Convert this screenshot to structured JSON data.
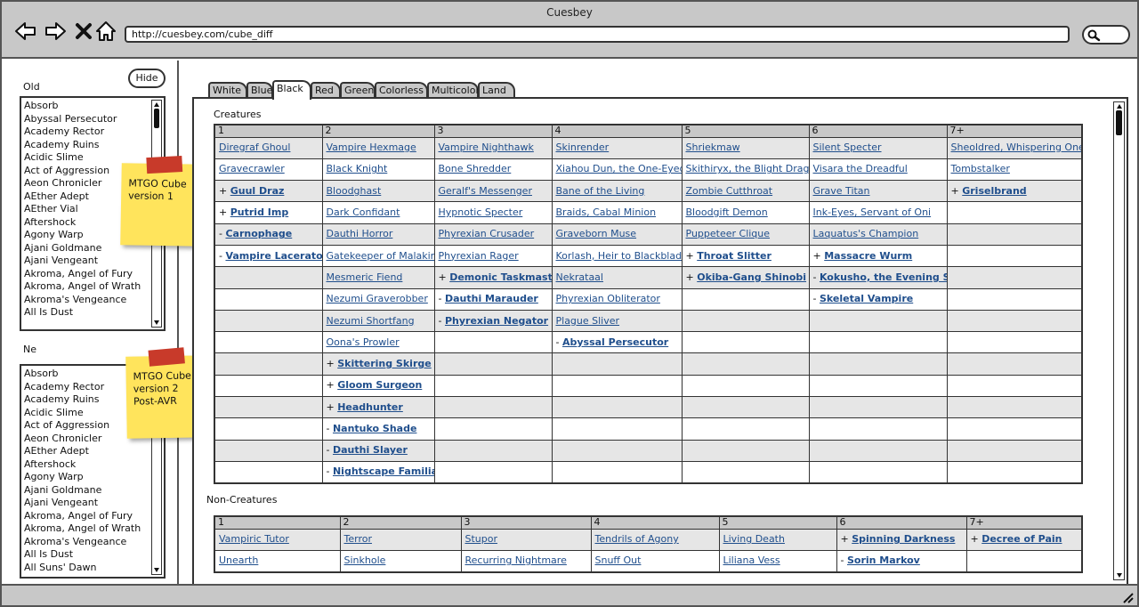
{
  "window": {
    "title": "Cuesbey"
  },
  "address_bar": {
    "url": "http://cuesbey.com/cube_diff"
  },
  "sidebar": {
    "hide_label": "Hide",
    "old_label": "Old",
    "new_label": "Ne",
    "old_items": [
      "Absorb",
      "Abyssal Persecutor",
      "Academy Rector",
      "Academy Ruins",
      "Acidic Slime",
      "Act of Aggression",
      "Aeon Chronicler",
      "AEther Adept",
      "AEther Vial",
      "Aftershock",
      "Agony Warp",
      "Ajani Goldmane",
      "Ajani Vengeant",
      "Akroma, Angel of Fury",
      "Akroma, Angel of Wrath",
      "Akroma's Vengeance",
      "All Is Dust"
    ],
    "new_items": [
      "Absorb",
      "Academy Rector",
      "Academy Ruins",
      "Acidic Slime",
      "Act of Aggression",
      "Aeon Chronicler",
      "AEther Adept",
      "Aftershock",
      "Agony Warp",
      "Ajani Goldmane",
      "Ajani Vengeant",
      "Akroma, Angel of Fury",
      "Akroma, Angel of Wrath",
      "Akroma's Vengeance",
      "All Is Dust",
      "All Suns' Dawn"
    ],
    "note_old": [
      "MTGO Cube",
      "version 1"
    ],
    "note_new": [
      "MTGO Cube",
      "version 2",
      "Post-AVR"
    ]
  },
  "tabs": [
    "White",
    "Blue",
    "Black",
    "Red",
    "Green",
    "Colorless",
    "Multicolor",
    "Land"
  ],
  "active_tab": "Black",
  "creatures": {
    "label": "Creatures",
    "columns": [
      "1",
      "2",
      "3",
      "4",
      "5",
      "6",
      "7+"
    ],
    "rows": [
      [
        "Diregraf Ghoul",
        "Vampire Hexmage",
        "Vampire Nighthawk",
        "Skinrender",
        "Shriekmaw",
        "Silent Specter",
        "Sheoldred, Whispering One"
      ],
      [
        "Gravecrawler",
        "Black Knight",
        "Bone Shredder",
        "Xiahou Dun, the One-Eyed",
        "Skithiryx, the Blight Dragon",
        "Visara the Dreadful",
        "Tombstalker"
      ],
      [
        "+ Guul Draz ",
        "Bloodghast",
        "Geralf's Messenger",
        "Bane of the Living",
        "Zombie Cutthroat",
        "Grave Titan",
        "+ Griselbrand"
      ],
      [
        "+ Putrid Imp",
        "Dark Confidant",
        "Hypnotic Specter",
        "Braids, Cabal Minion",
        "Bloodgift Demon",
        "Ink-Eyes, Servant of Oni",
        ""
      ],
      [
        "- Carnophage",
        "Dauthi Horror",
        "Phyrexian Crusader",
        "Graveborn Muse",
        "Puppeteer Clique",
        "Laquatus's Champion",
        ""
      ],
      [
        "- Vampire Lacerator",
        "Gatekeeper of Malakir",
        "Phyrexian Rager",
        "Korlash, Heir to Blackblade",
        "+ Throat Slitter",
        "+ Massacre Wurm",
        ""
      ],
      [
        "",
        "Mesmeric Fiend",
        "+ Demonic Taskmaster",
        "Nekrataal",
        "+ Okiba-Gang Shinobi",
        "- Kokusho, the Evening Star",
        ""
      ],
      [
        "",
        "Nezumi Graverobber",
        "- Dauthi Marauder",
        "Phyrexian Obliterator",
        "",
        "- Skeletal Vampire",
        ""
      ],
      [
        "",
        "Nezumi Shortfang",
        "- Phyrexian Negator",
        "Plague Sliver",
        "",
        "",
        ""
      ],
      [
        "",
        "Oona's Prowler",
        "",
        "- Abyssal Persecutor",
        "",
        "",
        ""
      ],
      [
        "",
        "+ Skittering Skirge",
        "",
        "",
        "",
        "",
        ""
      ],
      [
        "",
        "+ Gloom Surgeon",
        "",
        "",
        "",
        "",
        ""
      ],
      [
        "",
        "+ Headhunter",
        "",
        "",
        "",
        "",
        ""
      ],
      [
        "",
        "- Nantuko Shade",
        "",
        "",
        "",
        "",
        ""
      ],
      [
        "",
        "- Dauthi Slayer",
        "",
        "",
        "",
        "",
        ""
      ],
      [
        "",
        "- Nightscape Familiar",
        "",
        "",
        "",
        "",
        ""
      ]
    ]
  },
  "noncreatures": {
    "label": "Non-Creatures",
    "columns": [
      "1",
      "2",
      "3",
      "4",
      "5",
      "6",
      "7+"
    ],
    "rows": [
      [
        "Vampiric Tutor",
        "Terror",
        "Stupor",
        "Tendrils of Agony",
        "Living Death",
        "+ Spinning Darkness",
        "+ Decree of Pain"
      ],
      [
        "Unearth",
        "Sinkhole",
        "Recurring Nightmare",
        "Snuff Out",
        "Liliana Vess",
        "- Sorin Markov",
        ""
      ]
    ]
  },
  "colors": {
    "link": "#1f4e8c",
    "chrome": "#c8c8c8",
    "note": "#ffe45c",
    "tape": "#c83a2a"
  },
  "icons": [
    "back-arrow-icon",
    "forward-arrow-icon",
    "close-x-icon",
    "home-icon",
    "search-icon",
    "resize-grip-icon"
  ]
}
